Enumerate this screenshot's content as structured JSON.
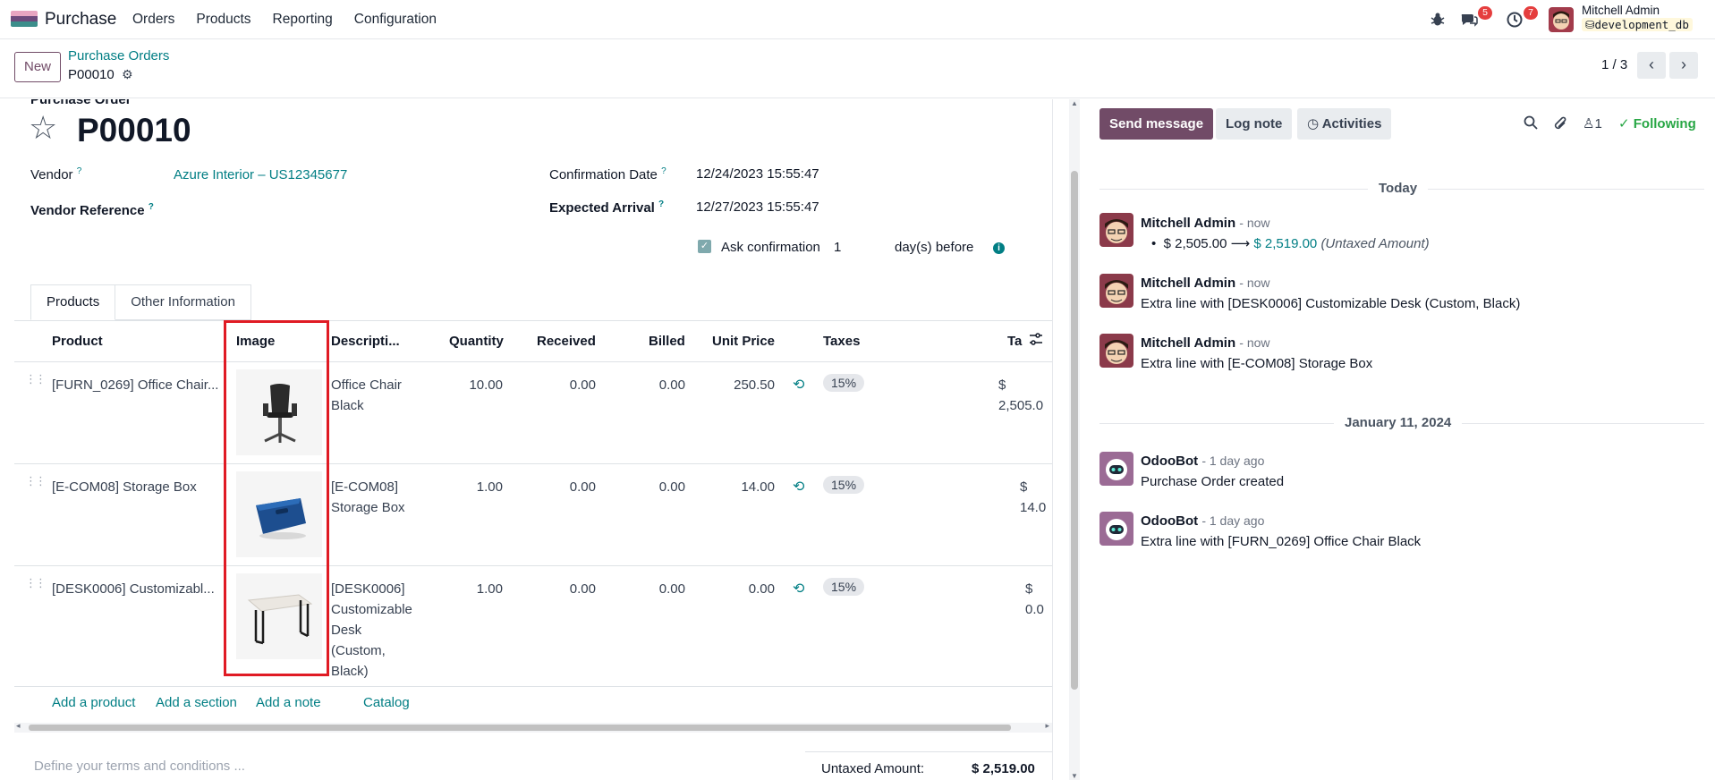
{
  "navbar": {
    "app_name": "Purchase",
    "menu": [
      "Orders",
      "Products",
      "Reporting",
      "Configuration"
    ],
    "messages_badge": "5",
    "activities_badge": "7",
    "user_name": "Mitchell Admin",
    "db_name": "development_db"
  },
  "control": {
    "new_label": "New",
    "breadcrumb_parent": "Purchase Orders",
    "breadcrumb_current": "P00010",
    "pager": "1 / 3"
  },
  "form": {
    "section_label": "Purchase Order",
    "title": "P00010",
    "vendor_label": "Vendor",
    "vendor_value": "Azure Interior – US12345677",
    "vendor_ref_label": "Vendor Reference",
    "confirmation_label": "Confirmation Date",
    "confirmation_value": "12/24/2023 15:55:47",
    "expected_label": "Expected Arrival",
    "expected_value": "12/27/2023 15:55:47",
    "ask_confirmation_label": "Ask confirmation",
    "ask_confirmation_days": "1",
    "days_before_label": "day(s) before",
    "help_mark": "?"
  },
  "tabs": [
    "Products",
    "Other Information"
  ],
  "table": {
    "headers": {
      "product": "Product",
      "image": "Image",
      "description": "Descripti...",
      "quantity": "Quantity",
      "received": "Received",
      "billed": "Billed",
      "unit_price": "Unit Price",
      "taxes": "Taxes",
      "tax_excl": "Ta"
    },
    "rows": [
      {
        "product": "[FURN_0269] Office Chair...",
        "description": [
          "Office Chair",
          "Black"
        ],
        "quantity": "10.00",
        "received": "0.00",
        "billed": "0.00",
        "unit_price": "250.50",
        "tax": "15%",
        "subtotal": "$ 2,505.0"
      },
      {
        "product": "[E-COM08] Storage Box",
        "description": [
          "[E-COM08]",
          "Storage Box"
        ],
        "quantity": "1.00",
        "received": "0.00",
        "billed": "0.00",
        "unit_price": "14.00",
        "tax": "15%",
        "subtotal": "$ 14.0"
      },
      {
        "product": "[DESK0006] Customizabl...",
        "description": [
          "[DESK0006]",
          "Customizable",
          "Desk",
          "(Custom,",
          "Black)"
        ],
        "quantity": "1.00",
        "received": "0.00",
        "billed": "0.00",
        "unit_price": "0.00",
        "tax": "15%",
        "subtotal": "$ 0.0"
      }
    ],
    "add_product": "Add a product",
    "add_section": "Add a section",
    "add_note": "Add a note",
    "catalog": "Catalog"
  },
  "footer": {
    "terms_placeholder": "Define your terms and conditions ...",
    "untaxed_label": "Untaxed Amount:",
    "untaxed_value": "$ 2,519.00"
  },
  "chatter": {
    "send_message": "Send message",
    "log_note": "Log note",
    "activities": "Activities",
    "followers_count": "1",
    "following": "Following",
    "sep_today": "Today",
    "sep_date": "January 11, 2024",
    "messages": [
      {
        "author": "Mitchell Admin",
        "time": "- now",
        "old_value": "$ 2,505.00",
        "new_value": "$ 2,519.00",
        "field": "(Untaxed Amount)"
      },
      {
        "author": "Mitchell Admin",
        "time": "- now",
        "body": "Extra line with [DESK0006] Customizable Desk (Custom, Black)"
      },
      {
        "author": "Mitchell Admin",
        "time": "- now",
        "body": "Extra line with [E-COM08] Storage Box"
      },
      {
        "author": "OdooBot",
        "time": "- 1 day ago",
        "body": "Purchase Order created"
      },
      {
        "author": "OdooBot",
        "time": "- 1 day ago",
        "body": "Extra line with [FURN_0269] Office Chair Black"
      }
    ]
  },
  "colors": {
    "brand": "#714b67",
    "link": "#017e84",
    "highlight": "#e01b24",
    "following": "#28a745"
  },
  "icons": {
    "app": "purchase-app-icon",
    "debug": "bug-icon",
    "messages": "chat-icon",
    "activities": "clock-icon",
    "gear": "gear-icon",
    "star": "star-icon",
    "reset": "history-icon",
    "column_settings": "sliders-icon",
    "search": "search-icon",
    "attachment": "paperclip-icon",
    "followers": "user-icon"
  }
}
